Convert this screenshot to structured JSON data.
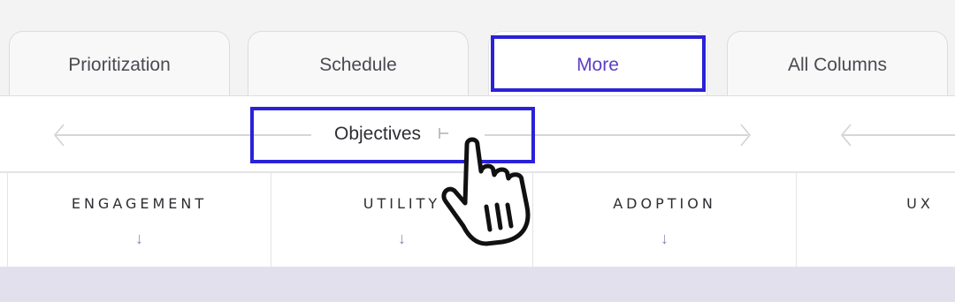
{
  "tabs": [
    {
      "label": "Prioritization",
      "active": false
    },
    {
      "label": "Schedule",
      "active": false
    },
    {
      "label": "More",
      "active": true
    },
    {
      "label": "All Columns",
      "active": false
    }
  ],
  "group": {
    "label": "Objectives",
    "sort_icon": "sort-arrow-icon"
  },
  "columns": [
    {
      "title": "ENGAGEMENT",
      "sort_icon": "↓"
    },
    {
      "title": "UTILITY",
      "sort_icon": "↓"
    },
    {
      "title": "ADOPTION",
      "sort_icon": "↓"
    },
    {
      "title": "UX",
      "sort_icon": ""
    }
  ],
  "colors": {
    "accent": "#5b3fc4",
    "focus_box": "#2a22d9",
    "band": "#e3e0ee"
  }
}
